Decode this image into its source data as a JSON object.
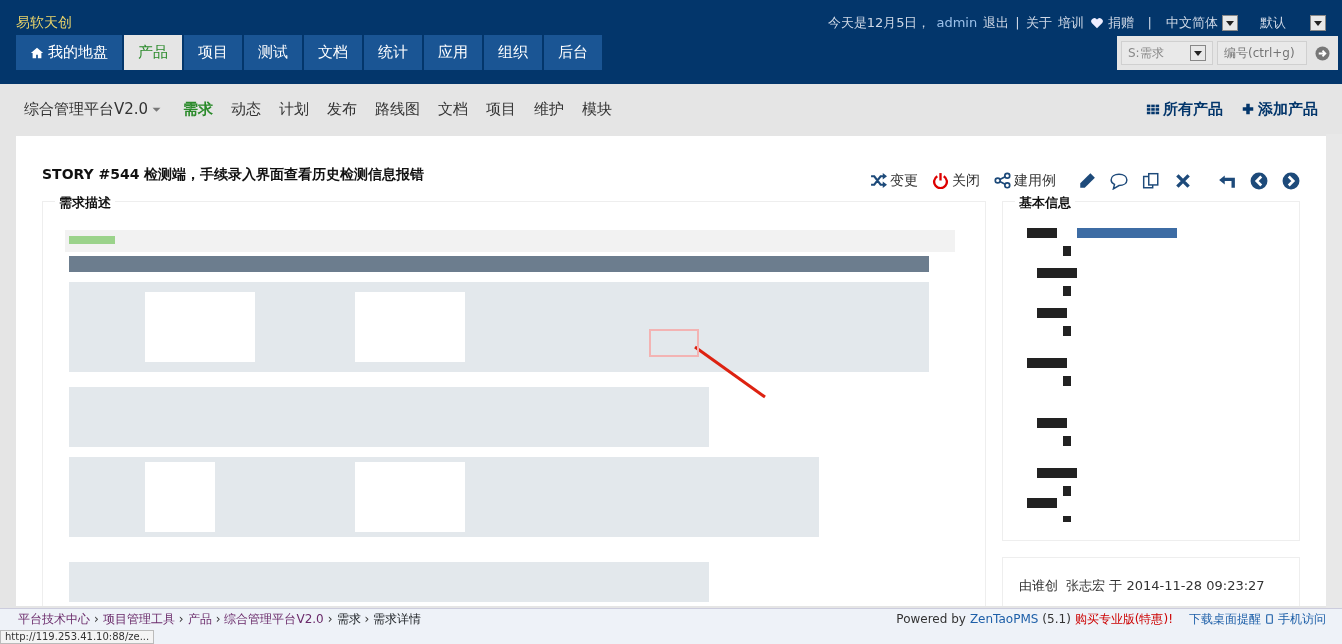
{
  "brand": "易软天创",
  "user_bar": {
    "date": "今天是12月5日，",
    "user": "admin",
    "logout": "退出",
    "separator_1": "|",
    "about": "关于",
    "training": "培训",
    "donate": "捐赠",
    "separator_2": "|",
    "language": "中文简体",
    "theme": "默认"
  },
  "main_tabs": [
    {
      "label": "我的地盘",
      "selected": false
    },
    {
      "label": "产品",
      "selected": true
    },
    {
      "label": "项目",
      "selected": false
    },
    {
      "label": "测试",
      "selected": false
    },
    {
      "label": "文档",
      "selected": false
    },
    {
      "label": "统计",
      "selected": false
    },
    {
      "label": "应用",
      "selected": false
    },
    {
      "label": "组织",
      "selected": false
    },
    {
      "label": "后台",
      "selected": false
    }
  ],
  "search": {
    "type": "S:需求",
    "placeholder": "编号(ctrl+g)"
  },
  "product_menu": {
    "product": "综合管理平台V2.0",
    "items": [
      {
        "label": "需求",
        "selected": true
      },
      {
        "label": "动态",
        "selected": false
      },
      {
        "label": "计划",
        "selected": false
      },
      {
        "label": "发布",
        "selected": false
      },
      {
        "label": "路线图",
        "selected": false
      },
      {
        "label": "文档",
        "selected": false
      },
      {
        "label": "项目",
        "selected": false
      },
      {
        "label": "维护",
        "selected": false
      },
      {
        "label": "模块",
        "selected": false
      }
    ],
    "right_links": [
      {
        "label": "所有产品"
      },
      {
        "label": "添加产品"
      }
    ]
  },
  "story": {
    "id": "STORY #544",
    "title": "检测端，手续录入界面查看历史检测信息报错",
    "actions": [
      {
        "kind": "text",
        "label": "变更"
      },
      {
        "kind": "text",
        "label": "关闭"
      },
      {
        "kind": "text",
        "label": "建用例"
      },
      {
        "kind": "icon"
      },
      {
        "kind": "icon"
      },
      {
        "kind": "icon"
      },
      {
        "kind": "icon"
      },
      {
        "kind": "icon"
      },
      {
        "kind": "icon"
      },
      {
        "kind": "icon"
      }
    ],
    "description_title": "需求描述",
    "basic_info_title": "基本信息",
    "history": [
      "由谁创  张志宏 于 2014-11-28 09:23:27"
    ]
  },
  "footer": {
    "breadcrumb": [
      {
        "label": "平台技术中心"
      },
      {
        "separator": "›",
        "label": "项目管理工具"
      },
      {
        "separator": "›",
        "label": "产品"
      },
      {
        "separator": "›",
        "label": "综合管理平台V2.0"
      },
      {
        "separator": "›",
        "label": "需求"
      },
      {
        "separator": "›",
        "label": "需求详情"
      }
    ],
    "powered": "Powered by",
    "brand": "ZenTaoPMS",
    "version": "(5.1)",
    "buy": "购买专业版(特惠)!",
    "download": "下载桌面提醒",
    "mobile": "手机访问"
  },
  "status_url": "http://119.253.41.10:88/ze..."
}
